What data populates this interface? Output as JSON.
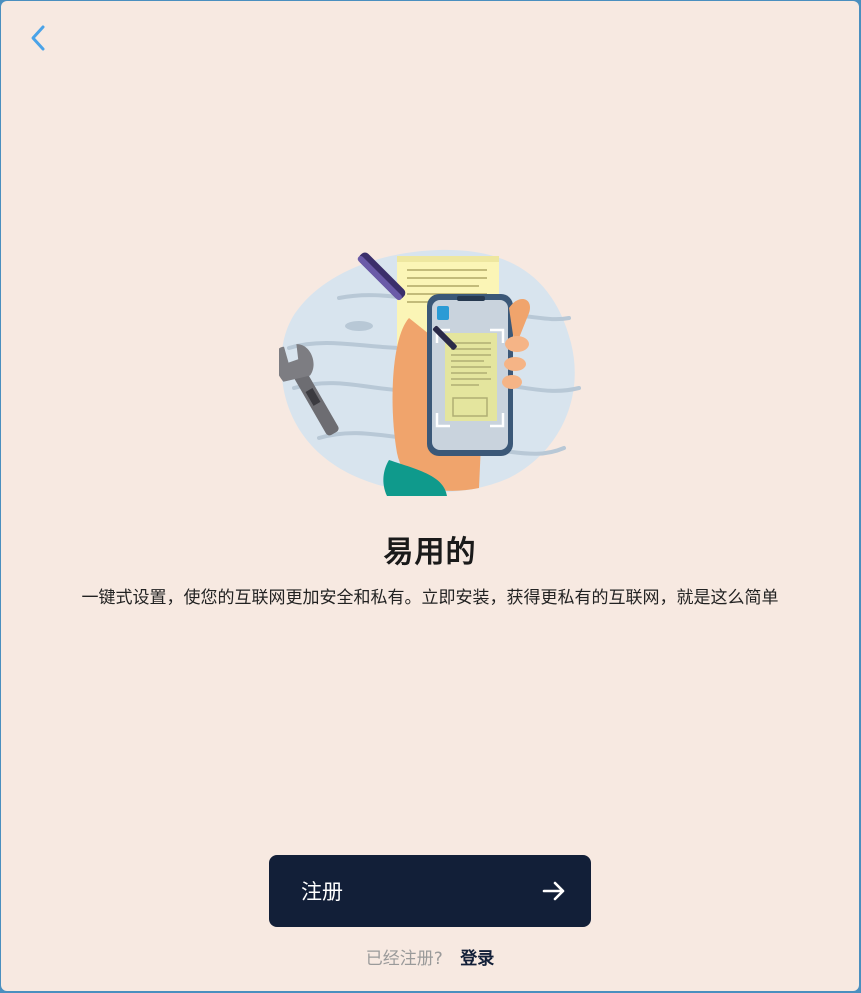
{
  "onboarding": {
    "title": "易用的",
    "description": "一键式设置，使您的互联网更加安全和私有。立即安装，获得更私有的互联网，就是这么简单"
  },
  "actions": {
    "register_label": "注册",
    "already_registered": "已经注册?",
    "login_label": "登录"
  },
  "icons": {
    "back": "chevron-left-icon",
    "arrow": "arrow-right-icon",
    "illustration": "phone-scan-document-illustration"
  },
  "colors": {
    "background": "#f7e9e1",
    "accent": "#4aa3e8",
    "button": "#121f38",
    "title": "#1a1a1a",
    "hint": "#9a9a9a"
  }
}
